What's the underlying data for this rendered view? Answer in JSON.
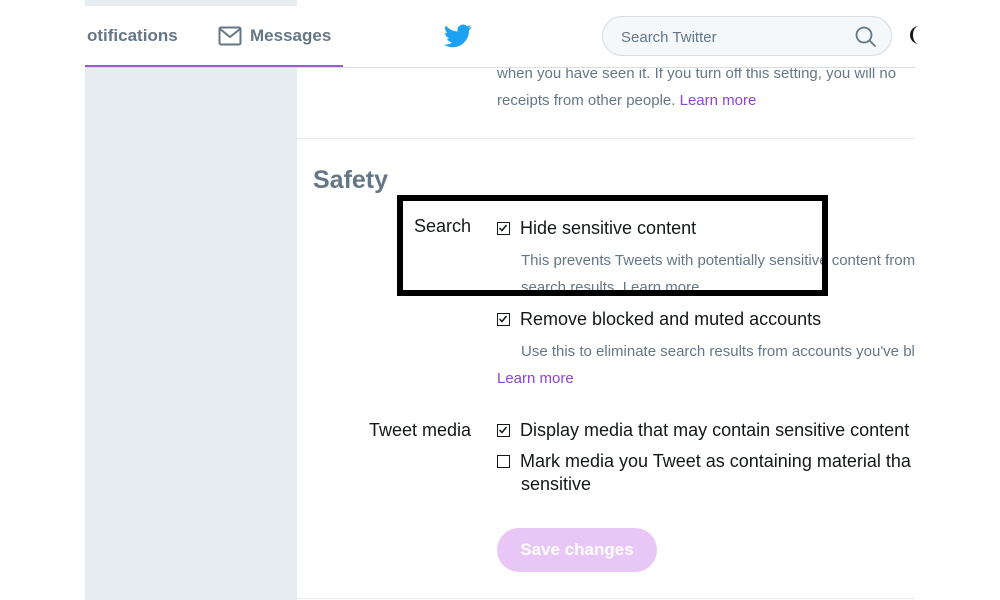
{
  "nav": {
    "notifications": "otifications",
    "messages": "Messages",
    "twitter_logo": "twitter-bird-icon",
    "search_placeholder": "Search Twitter"
  },
  "previous_setting": {
    "line1": "when you have seen it. If you turn off this setting, you will no",
    "line2": "receipts from other people.",
    "learn_more": "Learn more"
  },
  "safety": {
    "title": "Safety",
    "search_label": "Search",
    "hide_sensitive": {
      "label": "Hide sensitive content",
      "checked": true,
      "description": "This prevents Tweets with potentially sensitive content from",
      "description_cut": "search results. Learn more"
    },
    "remove_blocked": {
      "label": "Remove blocked and muted accounts",
      "checked": true,
      "description": "Use this to eliminate search results from accounts you've blo",
      "learn_more": "Learn more"
    },
    "tweet_media_label": "Tweet media",
    "display_media": {
      "label": "Display media that may contain sensitive content",
      "checked": true
    },
    "mark_media": {
      "label": "Mark media you Tweet as containing material tha",
      "label_line2": "sensitive",
      "checked": false
    },
    "save_button": "Save changes"
  },
  "colors": {
    "accent": "#8e44d6",
    "button_disabled": "#e8c7f6",
    "twitter_blue": "#1da1f2",
    "annotation": "#000000"
  }
}
